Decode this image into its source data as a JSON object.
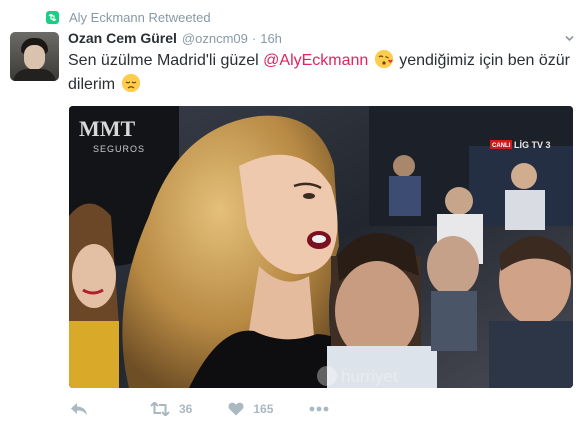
{
  "retweet_context": {
    "label": "Aly Eckmann Retweeted",
    "icon": "retweet-icon"
  },
  "tweet": {
    "author_name": "Ozan Cem Gürel",
    "author_handle": "@ozncm09",
    "separator": "·",
    "time": "16h",
    "text_part1": "Sen üzülme Madrid'li güzel ",
    "mention": "@AlyEckmann",
    "text_part2": " yendiğimiz için ben özür dilerim ",
    "emoji_1": "face-throwing-kiss-emoji",
    "emoji_2": "disappointed-face-emoji"
  },
  "media": {
    "logo_text": "MMT",
    "logo_subtext": "SEGUROS",
    "broadcast_badge": "CANLI",
    "channel": "LİG TV 3",
    "watermark": "hurriyet"
  },
  "actions": {
    "retweets": "36",
    "likes": "165"
  },
  "colors": {
    "mention": "#e0245e",
    "retweet_green": "#19cf86",
    "muted": "#8899a6",
    "action_gray": "#aab8c2"
  }
}
